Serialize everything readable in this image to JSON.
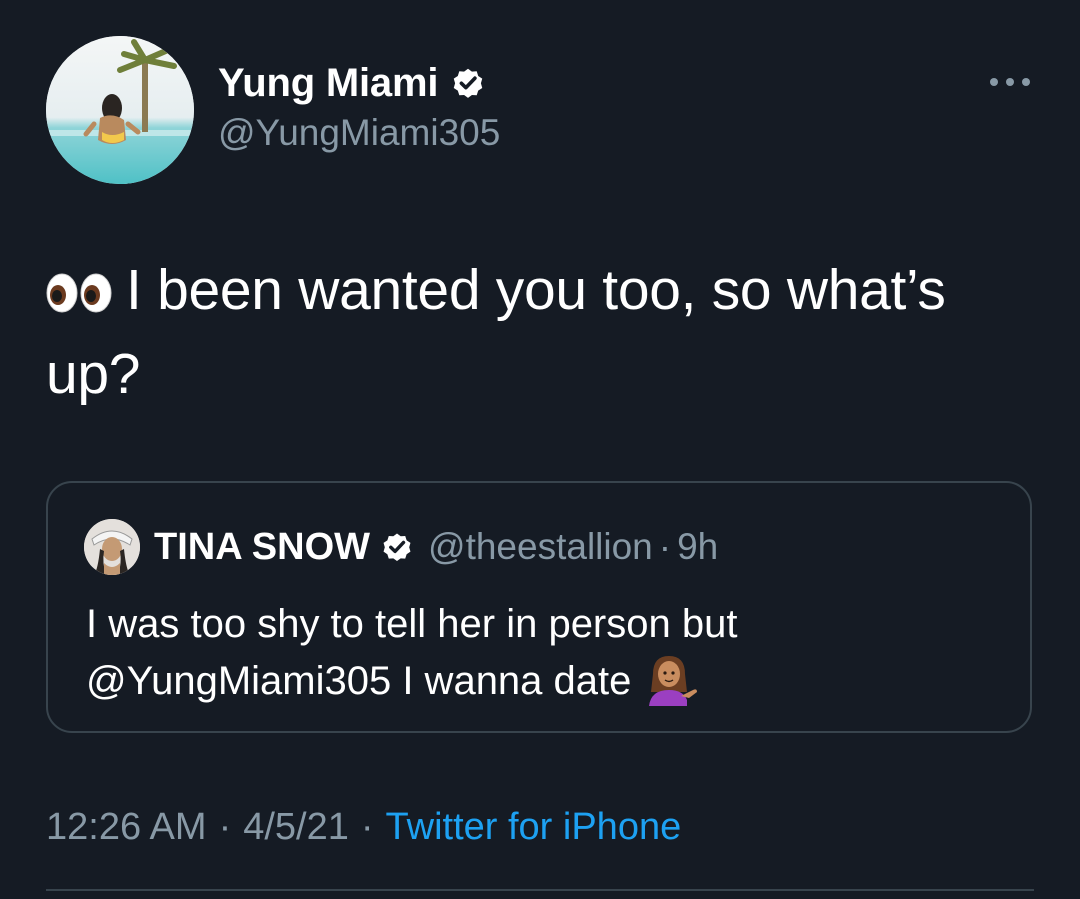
{
  "tweet": {
    "author": {
      "display_name": "Yung Miami",
      "handle": "@YungMiami305",
      "verified_icon": "verified-badge-icon"
    },
    "text": "I been wanted you too, so what’s up?",
    "leading_emoji": "eyes-icon",
    "quoted": {
      "display_name": "TINA SNOW",
      "handle": "@theestallion",
      "separator": "·",
      "time": "9h",
      "text": "I was too shy to tell her in person but @YungMiami305 I wanna date",
      "trailing_emoji": "woman-tipping-hand-icon"
    },
    "meta": {
      "time": "12:26 AM",
      "date": "4/5/21",
      "separator": "·",
      "source": "Twitter for iPhone"
    }
  },
  "colors": {
    "background": "#151b24",
    "primary_text": "#ffffff",
    "secondary_text": "#8899a6",
    "link": "#1da1f2",
    "border": "#38444d"
  }
}
